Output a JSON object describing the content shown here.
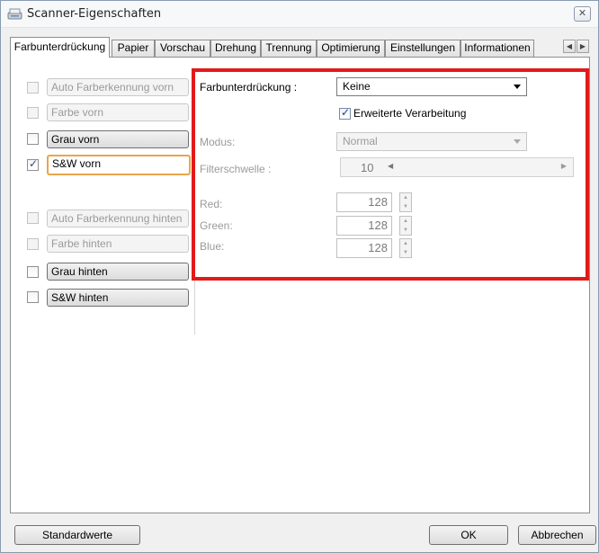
{
  "window": {
    "title": "Scanner-Eigenschaften",
    "close_symbol": "✕"
  },
  "tabs": [
    "Farbunterdrückung",
    "Papier",
    "Vorschau",
    "Drehung",
    "Trennung",
    "Optimierung",
    "Einstellungen",
    "Informationen"
  ],
  "tab_scroll": {
    "left": "◀",
    "right": "▶"
  },
  "side_options": [
    {
      "label": "Auto Farberkennung vorn",
      "checked": false,
      "enabled": false
    },
    {
      "label": "Farbe vorn",
      "checked": false,
      "enabled": false
    },
    {
      "label": "Grau vorn",
      "checked": false,
      "enabled": true
    },
    {
      "label": "S&W vorn",
      "checked": true,
      "enabled": true
    },
    {
      "label": "Auto Farberkennung hinten",
      "checked": false,
      "enabled": false
    },
    {
      "label": "Farbe hinten",
      "checked": false,
      "enabled": false
    },
    {
      "label": "Grau hinten",
      "checked": false,
      "enabled": true
    },
    {
      "label": "S&W hinten",
      "checked": false,
      "enabled": true
    }
  ],
  "settings": {
    "dropout_label": "Farbunterdrückung :",
    "dropout_value": "Keine",
    "advanced_label": "Erweiterte Verarbeitung",
    "advanced_checked": true,
    "mode_label": "Modus:",
    "mode_value": "Normal",
    "threshold_label": "Filterschwelle :",
    "threshold_value": "10",
    "red_label": "Red:",
    "red_value": "128",
    "green_label": "Green:",
    "green_value": "128",
    "blue_label": "Blue:",
    "blue_value": "128"
  },
  "footer": {
    "defaults_label": "Standardwerte",
    "ok_label": "OK",
    "cancel_label": "Abbrechen"
  },
  "colors": {
    "highlight": "#e21a1a",
    "selection": "#e8a64a"
  }
}
